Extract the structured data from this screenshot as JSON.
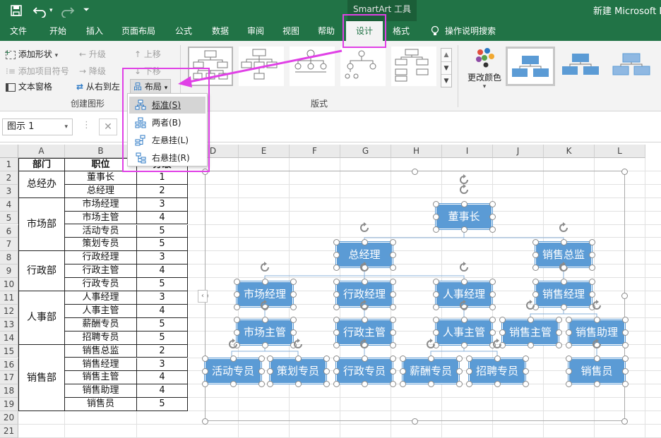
{
  "title_bar": {
    "window_title": "新建 Microsoft E",
    "context_tab_group": "SmartArt 工具",
    "save_icon": "save-icon",
    "undo_icon": "undo-icon",
    "redo_icon": "redo-icon",
    "customize_icon": "customize-qat-icon"
  },
  "tabs": [
    "文件",
    "开始",
    "插入",
    "页面布局",
    "公式",
    "数据",
    "审阅",
    "视图",
    "帮助",
    "设计",
    "格式"
  ],
  "active_tab": "设计",
  "tell_me": "操作说明搜索",
  "ribbon": {
    "create_graphic": {
      "add_shape": "添加形状",
      "add_bullet": "添加项目符号",
      "text_pane": "文本窗格",
      "promote": "升级",
      "demote": "降级",
      "right_to_left": "从右到左",
      "layout": "布局",
      "move_up": "上移",
      "move_down": "下移",
      "group_label": "创建图形"
    },
    "layouts_label": "版式",
    "change_colors": "更改颜色"
  },
  "layout_menu": {
    "items": [
      "标准(S)",
      "两者(B)",
      "左悬挂(L)",
      "右悬挂(R)"
    ]
  },
  "name_box": "图示 1",
  "columns": [
    "A",
    "B",
    "C",
    "D",
    "E",
    "F",
    "G",
    "H",
    "I",
    "J",
    "K",
    "L"
  ],
  "rows": [
    "1",
    "2",
    "3",
    "4",
    "5",
    "6",
    "7",
    "8",
    "9",
    "10",
    "11",
    "12",
    "13",
    "14",
    "15",
    "16",
    "17",
    "18",
    "19",
    "20",
    "21"
  ],
  "table": {
    "headers": [
      "部门",
      "职位",
      "分级"
    ],
    "departments": [
      {
        "name": "总经办",
        "rows": [
          [
            "董事长",
            "1"
          ],
          [
            "总经理",
            "2"
          ]
        ]
      },
      {
        "name": "市场部",
        "rows": [
          [
            "市场经理",
            "3"
          ],
          [
            "市场主管",
            "4"
          ],
          [
            "活动专员",
            "5"
          ],
          [
            "策划专员",
            "5"
          ]
        ]
      },
      {
        "name": "行政部",
        "rows": [
          [
            "行政经理",
            "3"
          ],
          [
            "行政主管",
            "4"
          ],
          [
            "行政专员",
            "5"
          ]
        ]
      },
      {
        "name": "人事部",
        "rows": [
          [
            "人事经理",
            "3"
          ],
          [
            "人事主管",
            "4"
          ],
          [
            "薪酬专员",
            "5"
          ],
          [
            "招聘专员",
            "5"
          ]
        ]
      },
      {
        "name": "销售部",
        "rows": [
          [
            "销售总监",
            "2"
          ],
          [
            "销售经理",
            "3"
          ],
          [
            "销售主管",
            "4"
          ],
          [
            "销售助理",
            "4"
          ],
          [
            "销售员",
            "5"
          ]
        ]
      }
    ]
  },
  "org_chart": {
    "level1": [
      "董事长"
    ],
    "level2": [
      "总经理",
      "销售总监"
    ],
    "level3": [
      "市场经理",
      "行政经理",
      "人事经理",
      "销售经理"
    ],
    "level4": [
      "市场主管",
      "行政主管",
      "人事主管",
      "销售主管",
      "销售助理"
    ],
    "level5": [
      "活动专员",
      "策划专员",
      "行政专员",
      "薪酬专员",
      "招聘专员",
      "销售员"
    ]
  },
  "colors": {
    "excel_green": "#217346",
    "node_fill": "#5b9bd5",
    "highlight": "#e040e6"
  }
}
